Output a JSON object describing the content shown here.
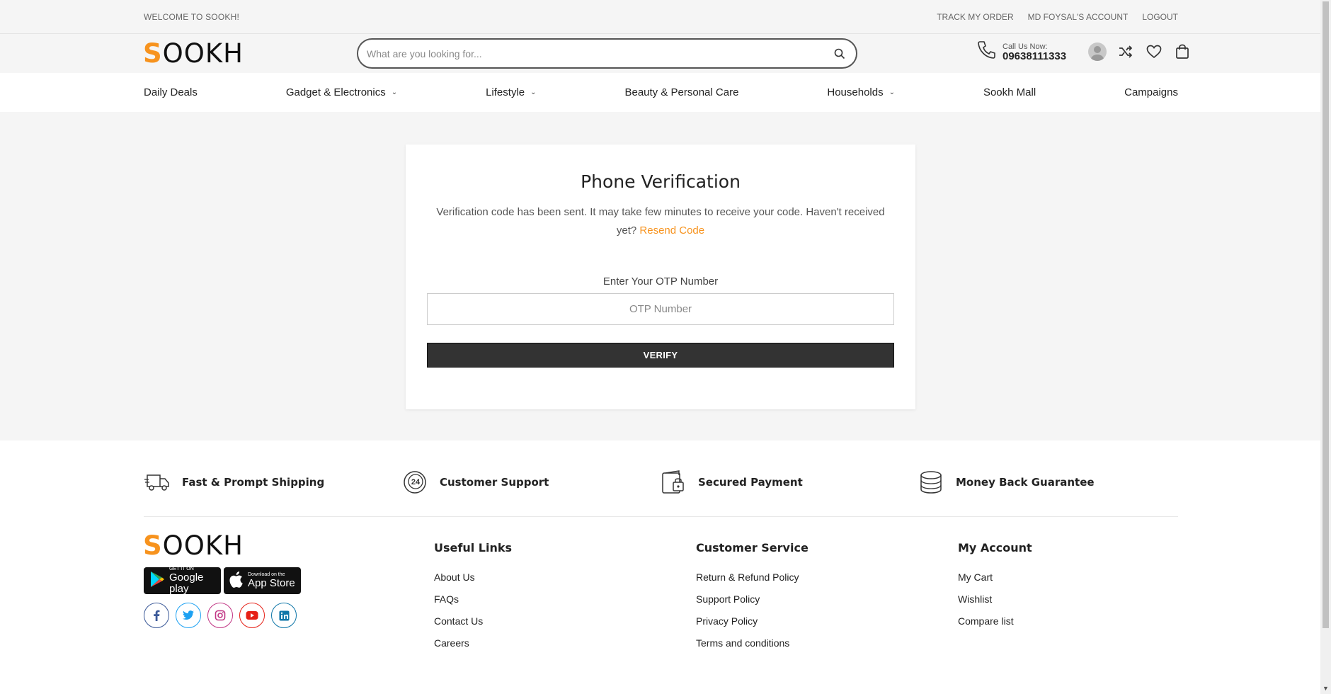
{
  "topbar": {
    "welcome": "WELCOME TO SOOKH!",
    "track_order": "TRACK MY ORDER",
    "account": "MD FOYSAL'S ACCOUNT",
    "logout": "LOGOUT"
  },
  "header": {
    "logo_first": "S",
    "logo_rest": "OOKH",
    "search_placeholder": "What are you looking for...",
    "call_label": "Call Us Now:",
    "call_number": "09638111333"
  },
  "nav": {
    "items": [
      {
        "label": "Daily Deals",
        "has_dropdown": false
      },
      {
        "label": "Gadget & Electronics",
        "has_dropdown": true
      },
      {
        "label": "Lifestyle",
        "has_dropdown": true
      },
      {
        "label": "Beauty & Personal Care",
        "has_dropdown": false
      },
      {
        "label": "Households",
        "has_dropdown": true
      },
      {
        "label": "Sookh Mall",
        "has_dropdown": false
      },
      {
        "label": "Campaigns",
        "has_dropdown": false
      }
    ]
  },
  "verification": {
    "title": "Phone Verification",
    "message": "Verification code has been sent. It may take few minutes to receive your code. Haven't received yet?",
    "resend": "Resend Code",
    "otp_label": "Enter Your OTP Number",
    "otp_placeholder": "OTP Number",
    "verify_button": "VERIFY"
  },
  "features": [
    {
      "label": "Fast & Prompt Shipping",
      "icon": "truck-icon"
    },
    {
      "label": "Customer Support",
      "icon": "support-24-icon"
    },
    {
      "label": "Secured Payment",
      "icon": "secure-wallet-icon"
    },
    {
      "label": "Money Back Guarantee",
      "icon": "coins-icon"
    }
  ],
  "footer": {
    "logo_first": "S",
    "logo_rest": "OOKH",
    "google_play_small": "GET IT ON",
    "google_play_big": "Google play",
    "app_store_small": "Download on the",
    "app_store_big": "App Store",
    "useful_links": {
      "title": "Useful Links",
      "links": [
        "About Us",
        "FAQs",
        "Contact Us",
        "Careers"
      ]
    },
    "customer_service": {
      "title": "Customer Service",
      "links": [
        "Return & Refund Policy",
        "Support Policy",
        "Privacy Policy",
        "Terms and conditions"
      ]
    },
    "my_account": {
      "title": "My Account",
      "links": [
        "My Cart",
        "Wishlist",
        "Compare list"
      ]
    }
  },
  "colors": {
    "accent": "#f7931e",
    "button_dark": "#333333",
    "facebook": "#3b5998",
    "twitter": "#1da1f2",
    "instagram": "#c13584",
    "youtube": "#e62117",
    "linkedin": "#0e76a8"
  }
}
